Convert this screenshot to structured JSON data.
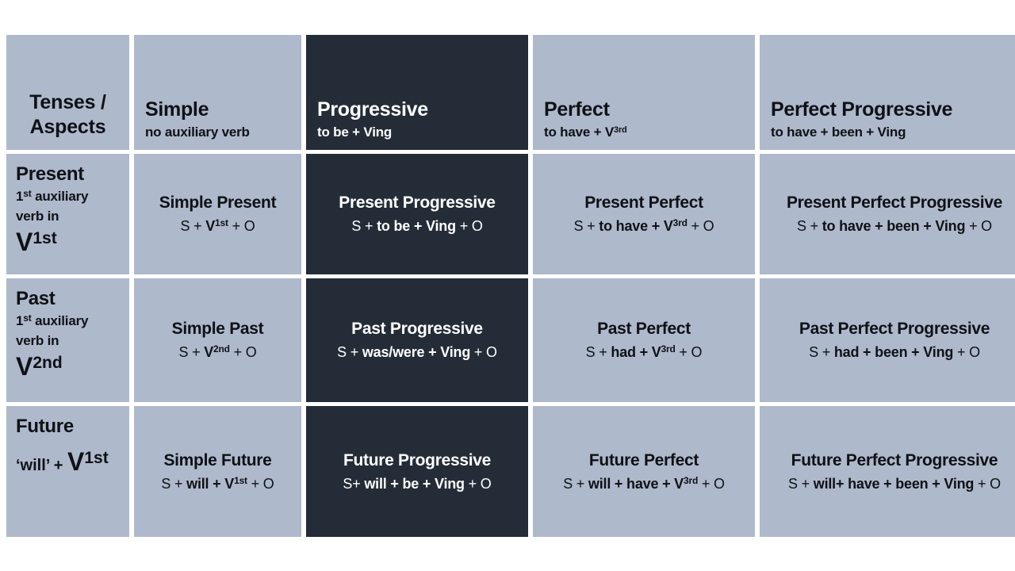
{
  "colors": {
    "cell_light": "#aeb9cb",
    "cell_dark": "#242c38",
    "text_dark": "#0e1116",
    "text_light": "#ffffff",
    "background": "#ffffff"
  },
  "table": {
    "corner": {
      "line1": "Tenses /",
      "line2": "Aspects"
    },
    "aspect_headers": [
      {
        "title": "Simple",
        "subtitle": "no auxiliary verb",
        "dark": false
      },
      {
        "title": "Progressive",
        "subtitle": "to be + Ving",
        "dark": true
      },
      {
        "title": "Perfect",
        "subtitle_pre": "to have + V",
        "subtitle_sup": "3rd",
        "dark": false
      },
      {
        "title": "Perfect Progressive",
        "subtitle": "to have + been + Ving",
        "dark": false
      }
    ],
    "rows": [
      {
        "name": "Present",
        "desc_line1": "1st auxiliary",
        "desc_line2": "verb in",
        "big_v": "V",
        "big_sup": "1st",
        "cells": [
          {
            "title": "Simple Present",
            "dark": false,
            "formula": [
              {
                "t": "S + ",
                "b": false
              },
              {
                "t": "V",
                "b": true
              },
              {
                "t": "1st",
                "b": true,
                "sup": true
              },
              {
                "t": " + O",
                "b": false
              }
            ]
          },
          {
            "title": "Present Progressive",
            "dark": true,
            "formula": [
              {
                "t": "S + ",
                "b": false
              },
              {
                "t": "to be + Ving",
                "b": true
              },
              {
                "t": " + O",
                "b": false
              }
            ]
          },
          {
            "title": "Present Perfect",
            "dark": false,
            "formula": [
              {
                "t": "S + ",
                "b": false
              },
              {
                "t": "to have + V",
                "b": true
              },
              {
                "t": "3rd",
                "b": true,
                "sup": true
              },
              {
                "t": " + O",
                "b": false
              }
            ]
          },
          {
            "title": "Present Perfect Progressive",
            "dark": false,
            "formula": [
              {
                "t": "S + ",
                "b": false
              },
              {
                "t": "to have + been + Ving",
                "b": true
              },
              {
                "t": " + O",
                "b": false
              }
            ]
          }
        ]
      },
      {
        "name": "Past",
        "desc_line1": "1st auxiliary",
        "desc_line2": "verb in",
        "big_v": "V",
        "big_sup": "2nd",
        "cells": [
          {
            "title": "Simple Past",
            "dark": false,
            "formula": [
              {
                "t": "S + ",
                "b": false
              },
              {
                "t": "V",
                "b": true
              },
              {
                "t": "2nd",
                "b": true,
                "sup": true
              },
              {
                "t": " + O",
                "b": false
              }
            ]
          },
          {
            "title": "Past Progressive",
            "dark": true,
            "formula": [
              {
                "t": "S + ",
                "b": false
              },
              {
                "t": "was/were + Ving",
                "b": true
              },
              {
                "t": " + O",
                "b": false
              }
            ]
          },
          {
            "title": "Past Perfect",
            "dark": false,
            "formula": [
              {
                "t": "S + ",
                "b": false
              },
              {
                "t": "had + V",
                "b": true
              },
              {
                "t": "3rd",
                "b": true,
                "sup": true
              },
              {
                "t": " + O",
                "b": false
              }
            ]
          },
          {
            "title": "Past Perfect Progressive",
            "dark": false,
            "formula": [
              {
                "t": "S + ",
                "b": false
              },
              {
                "t": "had + been + Ving",
                "b": true
              },
              {
                "t": " + O",
                "b": false
              }
            ]
          }
        ]
      },
      {
        "name": "Future",
        "will_prefix": "‘will’ + ",
        "big_v": "V",
        "big_sup": "1st",
        "cells": [
          {
            "title": "Simple Future",
            "dark": false,
            "formula": [
              {
                "t": "S + ",
                "b": false
              },
              {
                "t": "will + V",
                "b": true
              },
              {
                "t": "1st",
                "b": true,
                "sup": true
              },
              {
                "t": " + O",
                "b": false
              }
            ]
          },
          {
            "title": "Future Progressive",
            "dark": true,
            "formula": [
              {
                "t": "S+ ",
                "b": false
              },
              {
                "t": "will + be + Ving",
                "b": true
              },
              {
                "t": " + O",
                "b": false
              }
            ]
          },
          {
            "title": "Future Perfect",
            "dark": false,
            "formula": [
              {
                "t": "S + ",
                "b": false
              },
              {
                "t": "will + have + V",
                "b": true
              },
              {
                "t": "3rd",
                "b": true,
                "sup": true
              },
              {
                "t": " + O",
                "b": false
              }
            ]
          },
          {
            "title": "Future Perfect Progressive",
            "dark": false,
            "formula": [
              {
                "t": "S + ",
                "b": false
              },
              {
                "t": "will+ have + been + Ving",
                "b": true
              },
              {
                "t": " + O",
                "b": false
              }
            ]
          }
        ]
      }
    ]
  }
}
